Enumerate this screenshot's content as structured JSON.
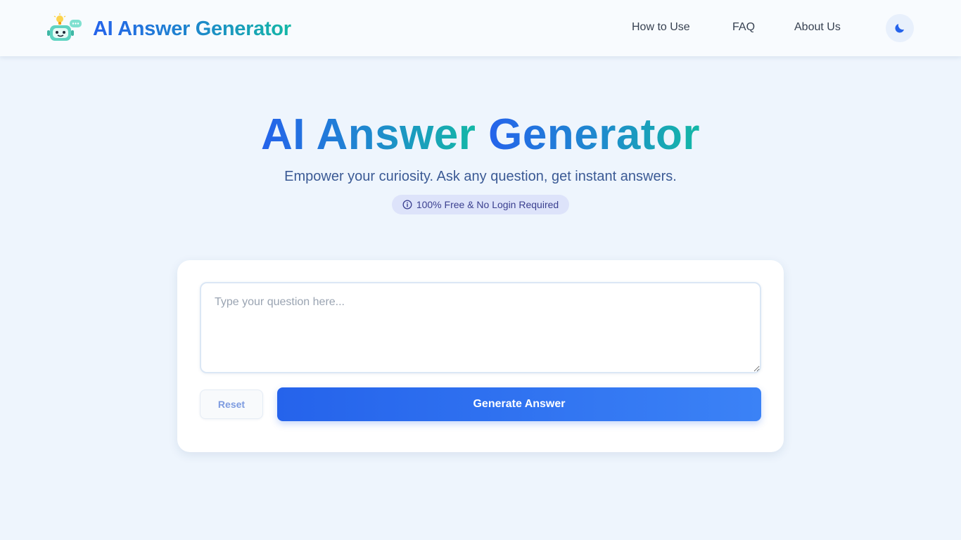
{
  "header": {
    "brand": "AI Answer Generator",
    "nav": [
      {
        "label": "How to Use"
      },
      {
        "label": "FAQ"
      },
      {
        "label": "About Us"
      }
    ],
    "theme_toggle_icon": "moon-icon"
  },
  "hero": {
    "title_part1": "AI Answer",
    "title_part2": "Generator",
    "subtitle": "Empower your curiosity. Ask any question, get instant answers.",
    "badge": "100% Free & No Login Required",
    "badge_icon": "info-icon"
  },
  "form": {
    "question_value": "",
    "question_placeholder": "Type your question here...",
    "reset_label": "Reset",
    "generate_label": "Generate Answer"
  },
  "colors": {
    "page_bg": "#eef5fd",
    "brand_blue": "#2563eb",
    "brand_teal": "#14b8a6",
    "button_blue": "#3b82f6"
  }
}
